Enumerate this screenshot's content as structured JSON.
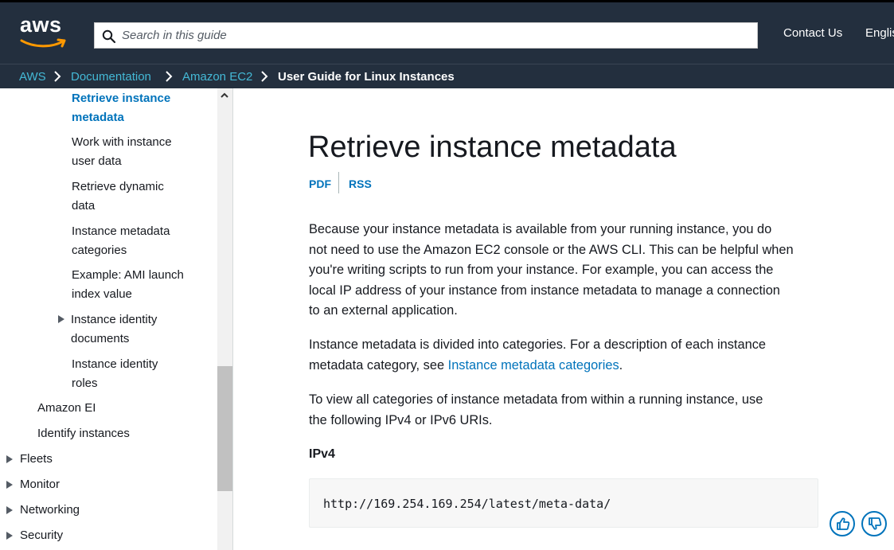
{
  "header": {
    "logo_text": "aws",
    "search_placeholder": "Search in this guide",
    "contact_label": "Contact Us",
    "language_label": "Englis"
  },
  "breadcrumb": {
    "items": [
      "AWS",
      "Documentation",
      "Amazon EC2",
      "User Guide for Linux Instances"
    ]
  },
  "sidebar": {
    "items": [
      {
        "label_line1": "Retrieve instance",
        "label_line2": "metadata",
        "active": true
      },
      {
        "label_line1": "Work with instance",
        "label_line2": "user data"
      },
      {
        "label_line1": "Retrieve dynamic",
        "label_line2": "data"
      },
      {
        "label_line1": "Instance metadata",
        "label_line2": "categories"
      },
      {
        "label_line1": "Example: AMI launch",
        "label_line2": "index value"
      },
      {
        "label_line1": "Instance identity",
        "label_line2": "documents",
        "expandable": true
      },
      {
        "label_line1": "Instance identity",
        "label_line2": "roles"
      },
      {
        "label": "Amazon EI"
      },
      {
        "label": "Identify instances"
      },
      {
        "label": "Fleets",
        "expandable": true
      },
      {
        "label": "Monitor",
        "expandable": true
      },
      {
        "label": "Networking",
        "expandable": true
      },
      {
        "label": "Security",
        "expandable": true
      }
    ]
  },
  "main": {
    "title": "Retrieve instance metadata",
    "pdf_label": "PDF",
    "rss_label": "RSS",
    "para1": {
      "lines": [
        "Because your instance metadata is available from your running instance, you do",
        "not need to use the Amazon EC2 console or the AWS CLI. This can be helpful when",
        "you're writing scripts to run from your instance. For example, you can access the",
        "local IP address of your instance from instance metadata to manage a connection",
        "to an external application."
      ]
    },
    "para2": {
      "line1": "Instance metadata is divided into categories. For a description of each instance",
      "line2_prefix": "metadata category, see ",
      "link": "Instance metadata categories",
      "line2_suffix": "."
    },
    "para3": {
      "line1": "To view all categories of instance metadata from within a running instance, use",
      "line2": "the following IPv4 or IPv6 URIs."
    },
    "ipv4_heading": "IPv4",
    "ipv4_code": "http://169.254.169.254/latest/meta-data/"
  },
  "feedback": {
    "icons": [
      "thumbs-up-icon",
      "thumbs-down-icon"
    ]
  },
  "colors": {
    "header_bg": "#232f3e",
    "link": "#0073bb",
    "breadcrumb_link": "#44b9d6",
    "logo_smile": "#ff9900"
  }
}
